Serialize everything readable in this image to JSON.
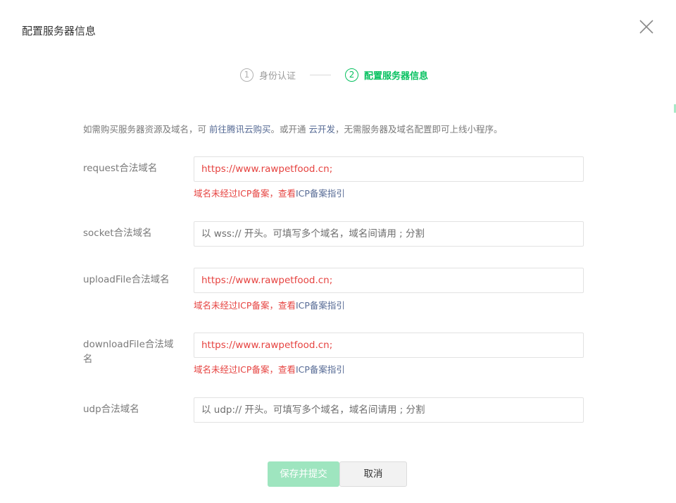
{
  "dialog": {
    "title": "配置服务器信息",
    "close_icon": "close-icon"
  },
  "steps": [
    {
      "num": "1",
      "label": "身份认证",
      "state": "done"
    },
    {
      "num": "2",
      "label": "配置服务器信息",
      "state": "active"
    }
  ],
  "tip": {
    "text1": "如需购买服务器资源及域名，可 ",
    "link1": "前往腾讯云购买",
    "text2": "。或开通 ",
    "link2": "云开发",
    "text3": "，无需服务器及域名配置即可上线小程序。"
  },
  "fields": {
    "request": {
      "label": "request合法域名",
      "value": "https://www.rawpetfood.cn;",
      "error_text": "域名未经过ICP备案，查看",
      "error_link": "ICP备案指引"
    },
    "socket": {
      "label": "socket合法域名",
      "placeholder": "以 wss:// 开头。可填写多个域名，域名间请用 ; 分割"
    },
    "uploadFile": {
      "label": "uploadFile合法域名",
      "value": "https://www.rawpetfood.cn;",
      "error_text": "域名未经过ICP备案，查看",
      "error_link": "ICP备案指引"
    },
    "downloadFile": {
      "label": "downloadFile合法域名",
      "value": "https://www.rawpetfood.cn;",
      "error_text": "域名未经过ICP备案，查看",
      "error_link": "ICP备案指引"
    },
    "udp": {
      "label": "udp合法域名",
      "placeholder": "以 udp:// 开头。可填写多个域名，域名间请用 ; 分割"
    }
  },
  "buttons": {
    "save_label": "保存并提交",
    "cancel_label": "取消"
  },
  "colors": {
    "accent": "#07c160",
    "error": "#e64340",
    "link": "#576b95",
    "save_disabled": "#9ee5bf"
  }
}
